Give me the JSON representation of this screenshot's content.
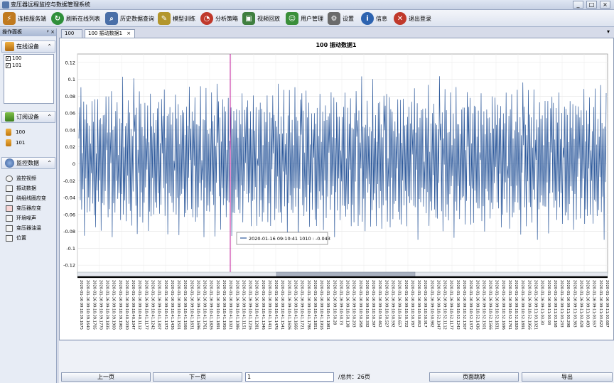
{
  "window": {
    "title": "变压器远程监控与数据管理系统",
    "controls": [
      "_",
      "□",
      "×"
    ]
  },
  "toolbar": {
    "items": [
      {
        "label": "连接服务端",
        "icon": "connect-server-icon",
        "color": "#c07a20"
      },
      {
        "label": "刷新在线列表",
        "icon": "refresh-icon",
        "color": "#2f8f3a"
      },
      {
        "label": "历史数据查询",
        "icon": "history-query-icon",
        "color": "#4a6fa8"
      },
      {
        "label": "模型训练",
        "icon": "model-training-icon",
        "color": "#b3962c"
      },
      {
        "label": "分析策略",
        "icon": "analysis-icon",
        "color": "#c0392b"
      },
      {
        "label": "视频回放",
        "icon": "video-playback-icon",
        "color": "#3f7f3f"
      },
      {
        "label": "用户管理",
        "icon": "user-management-icon",
        "color": "#3a8f3a"
      },
      {
        "label": "设置",
        "icon": "settings-icon",
        "color": "#6b6b6b"
      },
      {
        "label": "信息",
        "icon": "info-icon",
        "color": "#2d63b0"
      },
      {
        "label": "退出登录",
        "icon": "logout-icon",
        "color": "#c0392b"
      }
    ]
  },
  "left_panel": {
    "header": "操作面板",
    "pin_icon": "ᵖ ×",
    "online_group": {
      "label": "在线设备",
      "devices": [
        "100",
        "101"
      ]
    },
    "subscribed_group": {
      "label": "订阅设备",
      "devices": [
        "100",
        "101"
      ]
    },
    "monitor_group": {
      "label": "监控数据",
      "items": [
        {
          "label": "监控视频",
          "icon": "eye-icon"
        },
        {
          "label": "振动数据",
          "icon": "vibration-chart-icon"
        },
        {
          "label": "绕组线圈应变",
          "icon": "winding-strain-icon"
        },
        {
          "label": "变压器应变",
          "icon": "transformer-strain-icon"
        },
        {
          "label": "环境噪声",
          "icon": "noise-chart-icon"
        },
        {
          "label": "变压器油温",
          "icon": "oil-temp-icon"
        },
        {
          "label": "位置",
          "icon": "location-icon"
        }
      ]
    }
  },
  "tabs": [
    {
      "label": "100",
      "active": false
    },
    {
      "label": "100 振动数据1",
      "active": true,
      "close": "×"
    }
  ],
  "tab_dropdown": "▾",
  "chart_data": {
    "type": "line",
    "title": "100 振动数据1",
    "ylim": [
      -0.13,
      0.13
    ],
    "y_ticks": [
      "0.12",
      "0.1",
      "0.08",
      "0.06",
      "0.04",
      "0.02",
      "0",
      "-0.02",
      "-0.04",
      "-0.06",
      "-0.08",
      "-0.1",
      "-0.12"
    ],
    "grid": true,
    "series": [
      {
        "color": "#2e5a9c",
        "description_shape": "dense oscillating vibration signal between roughly -0.09 and 0.11",
        "values": [
          0.02,
          0.06,
          -0.05,
          0.07,
          -0.06,
          0.03,
          -0.02,
          0.08,
          -0.07,
          0.05,
          -0.04,
          0.06,
          -0.06,
          0.04,
          -0.03,
          0.07,
          -0.05,
          0.02,
          -0.01,
          0.06,
          -0.07,
          0.05,
          -0.05,
          0.08,
          -0.06,
          0.03,
          -0.04,
          0.06,
          -0.05,
          0.04,
          -0.03,
          0.07,
          -0.06,
          0.05,
          -0.04,
          0.06,
          -0.07,
          0.04,
          -0.03,
          0.08
        ]
      }
    ],
    "tooltip": "2020-01-16 09:10:41 1010 : -0.043",
    "x_labels": [
      "2020-01-16 09:10:39.1675",
      "2020-01-16 09:10:39.1640",
      "2020-01-16 09:10:39.1705",
      "2020-01-16 09:10:39.1770",
      "2020-01-16 09:10:39.1835",
      "2020-01-16 09:10:39.1900",
      "2020-01-16 09:10:39.1965",
      "2020-01-16 09:10:40.2030",
      "2020-01-16 09:10:40.1047",
      "2020-01-16 09:10:40.1112",
      "2020-01-16 09:10:41.1177",
      "2020-01-16 09:10:41.1242",
      "2020-01-16 09:10:41.1307",
      "2020-01-16 09:10:41.1372",
      "2020-01-16 09:10:41.1436",
      "2020-01-16 09:10:41.1501",
      "2020-01-16 09:10:41.1566",
      "2020-01-16 09:10:41.1631",
      "2020-01-16 09:10:41.1696",
      "2020-01-16 09:10:41.1761",
      "2020-01-16 09:10:41.1826",
      "2020-01-16 09:10:41.1891",
      "2020-01-16 09:10:41.1956",
      "2020-01-16 09:10:41.1021",
      "2020-01-16 09:10:41.1086",
      "2020-01-16 09:10:41.1151",
      "2020-01-16 09:10:41.1216",
      "2020-01-16 09:10:41.1281",
      "2020-01-16 09:10:41.1346",
      "2020-01-16 09:10:41.1411",
      "2020-01-16 09:10:41.1476",
      "2020-01-16 09:10:41.1541",
      "2020-01-16 09:10:41.1606",
      "2020-01-16 09:10:41.1666",
      "2020-01-16 09:10:41.1721",
      "2020-01-16 09:10:41.1786",
      "2020-01-16 09:10:41.1851",
      "2020-01-16 09:10:41.1916",
      "2020-01-16 09:10:41.1981",
      "2020-01-16 09:10:50.28",
      "2020-01-16 09:10:50.73",
      "2020-01-16 09:10:50.138",
      "2020-01-16 09:10:50.203",
      "2020-01-16 09:10:50.268",
      "2020-01-16 09:10:50.332",
      "2020-01-16 09:10:50.397",
      "2020-01-16 09:10:50.462",
      "2020-01-16 09:10:50.527",
      "2020-01-16 09:10:50.592",
      "2020-01-16 09:10:50.657",
      "2020-01-16 09:10:50.722",
      "2020-01-16 09:10:50.787",
      "2020-01-16 09:10:50.852",
      "2020-01-16 09:10:50.917",
      "2020-01-16 09:10:50.982",
      "2020-01-16 09:10:52.1047",
      "2020-01-16 09:10:52.1112",
      "2020-01-16 09:10:52.1177",
      "2020-01-16 09:10:52.1242",
      "2020-01-16 09:10:52.1307",
      "2020-01-16 09:10:52.1372",
      "2020-01-16 09:10:52.1436",
      "2020-01-16 09:10:52.1501",
      "2020-01-16 09:10:52.1566",
      "2020-01-16 09:10:52.1631",
      "2020-01-16 09:10:52.1696",
      "2020-01-16 09:10:52.1761",
      "2020-01-16 09:10:52.1826",
      "2020-01-16 09:10:52.1891",
      "2020-01-16 09:10:52.1956",
      "2020-01-16 09:11:03.1021",
      "2020-01-16 09:11:03.30",
      "2020-01-16 09:11:03.93",
      "2020-01-16 09:11:03.168",
      "2020-01-16 09:11:03.233",
      "2020-01-16 09:11:03.298",
      "2020-01-16 09:11:03.363",
      "2020-01-16 09:11:03.428",
      "2020-01-16 09:11:03.493",
      "2020-01-16 09:11:03.557",
      "2020-01-16 09:11:03.622",
      "2020-01-16 09:11:03.687"
    ]
  },
  "bottom_bar": {
    "prev_label": "上一页",
    "next_label": "下一页",
    "page_value": "1",
    "total_text": "/总共：26页",
    "jump_label": "页面跳转",
    "export_label": "导出"
  }
}
